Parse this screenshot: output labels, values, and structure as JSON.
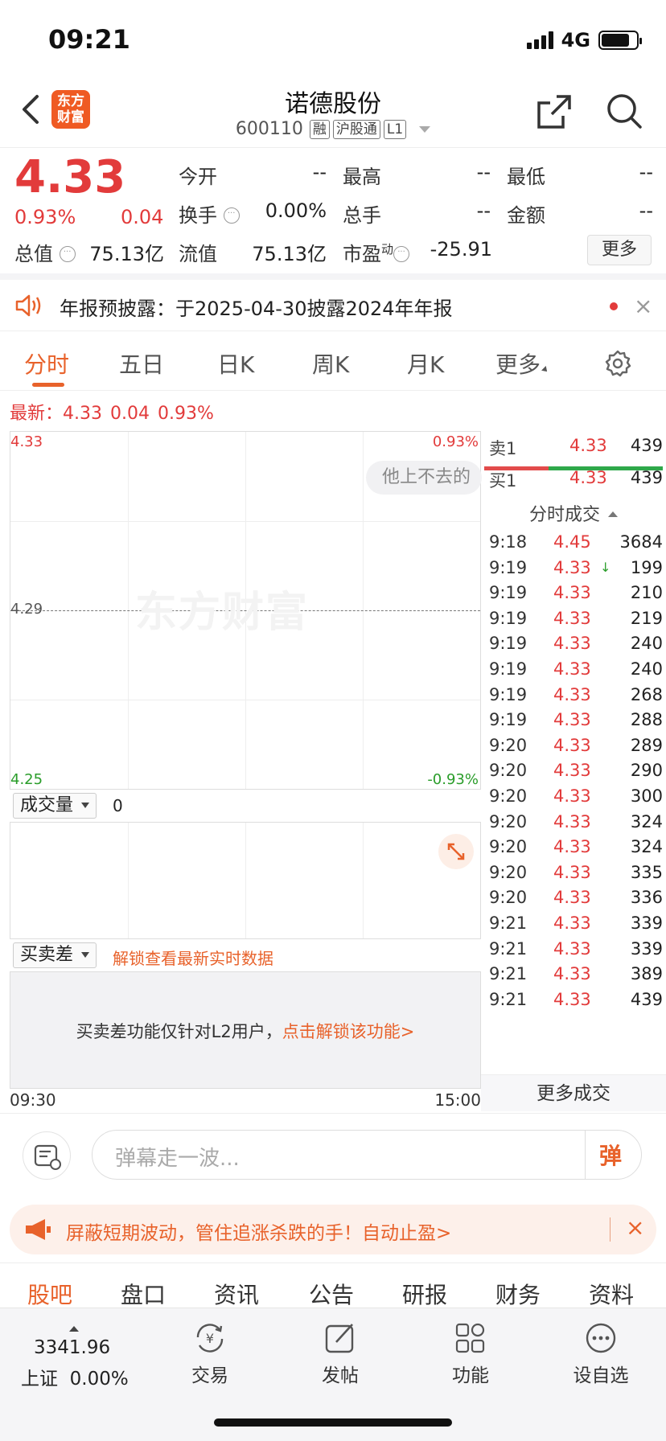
{
  "status_bar": {
    "time": "09:21",
    "network": "4G"
  },
  "nav": {
    "logo": [
      "东方",
      "财富"
    ],
    "title": "诺德股份",
    "code": "600110",
    "tags": [
      "融",
      "沪股通",
      "L1"
    ]
  },
  "quote": {
    "price": "4.33",
    "change_pct": "0.93%",
    "change": "0.04",
    "cells": [
      {
        "label": "今开",
        "value": "--"
      },
      {
        "label": "最高",
        "value": "--"
      },
      {
        "label": "最低",
        "value": "--"
      },
      {
        "label": "换手",
        "value": "0.00%"
      },
      {
        "label": "总手",
        "value": "--"
      },
      {
        "label": "金额",
        "value": "--"
      },
      {
        "label": "总值",
        "value": "75.13亿"
      },
      {
        "label": "流值",
        "value": "75.13亿"
      },
      {
        "label": "市盈",
        "superscript": "动",
        "value": "-25.91"
      }
    ],
    "more_label": "更多"
  },
  "notice": {
    "text": "年报预披露：于2025-04-30披露2024年年报",
    "close": "×"
  },
  "tabs": [
    "分时",
    "五日",
    "日K",
    "周K",
    "月K",
    "更多"
  ],
  "latest": {
    "label": "最新：",
    "price": "4.33",
    "change": "0.04",
    "pct": "0.93%"
  },
  "chart": {
    "y_top": "4.33",
    "y_mid": "4.29",
    "y_bottom": "4.25",
    "pct_top": "0.93%",
    "pct_bottom": "-0.93%",
    "watermark": "东方财富",
    "danmaku_bubble": "他上不去的",
    "time_start": "09:30",
    "time_end": "15:00"
  },
  "volume": {
    "selector": "成交量",
    "value": "0"
  },
  "diff": {
    "selector": "买卖差",
    "unlock_text": "解锁查看最新实时数据",
    "message": "买卖差功能仅针对L2用户，",
    "message_link": "点击解锁该功能>"
  },
  "order_book": {
    "ask": {
      "label": "卖1",
      "price": "4.33",
      "volume": "439"
    },
    "bid": {
      "label": "买1",
      "price": "4.33",
      "volume": "439"
    }
  },
  "ticks_title": "分时成交",
  "ticks": [
    {
      "time": "9:18",
      "price": "4.45",
      "volume": "3684"
    },
    {
      "time": "9:19",
      "price": "4.33",
      "arrow": "↓",
      "volume": "199"
    },
    {
      "time": "9:19",
      "price": "4.33",
      "volume": "210"
    },
    {
      "time": "9:19",
      "price": "4.33",
      "volume": "219"
    },
    {
      "time": "9:19",
      "price": "4.33",
      "volume": "240"
    },
    {
      "time": "9:19",
      "price": "4.33",
      "volume": "240"
    },
    {
      "time": "9:19",
      "price": "4.33",
      "volume": "268"
    },
    {
      "time": "9:19",
      "price": "4.33",
      "volume": "288"
    },
    {
      "time": "9:20",
      "price": "4.33",
      "volume": "289"
    },
    {
      "time": "9:20",
      "price": "4.33",
      "volume": "290"
    },
    {
      "time": "9:20",
      "price": "4.33",
      "volume": "300"
    },
    {
      "time": "9:20",
      "price": "4.33",
      "volume": "324"
    },
    {
      "time": "9:20",
      "price": "4.33",
      "volume": "324"
    },
    {
      "time": "9:20",
      "price": "4.33",
      "volume": "335"
    },
    {
      "time": "9:20",
      "price": "4.33",
      "volume": "336"
    },
    {
      "time": "9:21",
      "price": "4.33",
      "volume": "339"
    },
    {
      "time": "9:21",
      "price": "4.33",
      "volume": "339"
    },
    {
      "time": "9:21",
      "price": "4.33",
      "volume": "389"
    },
    {
      "time": "9:21",
      "price": "4.33",
      "volume": "439"
    }
  ],
  "more_trades": "更多成交",
  "danmaku": {
    "placeholder": "弹幕走一波...",
    "send": "弹"
  },
  "promo": {
    "text": "屏蔽短期波动，管住追涨杀跌的手！自动止盈>",
    "close": "×"
  },
  "sub_tabs": [
    "股吧",
    "盘口",
    "资讯",
    "公告",
    "研报",
    "财务",
    "资料"
  ],
  "bottom_bar": {
    "index_value": "3341.96",
    "index_name": "上证",
    "index_pct": "0.00%",
    "items": [
      "交易",
      "发帖",
      "功能",
      "设自选"
    ]
  },
  "colors": {
    "up": "#e23b3b",
    "down": "#2a9d2a",
    "accent": "#e8622b"
  }
}
